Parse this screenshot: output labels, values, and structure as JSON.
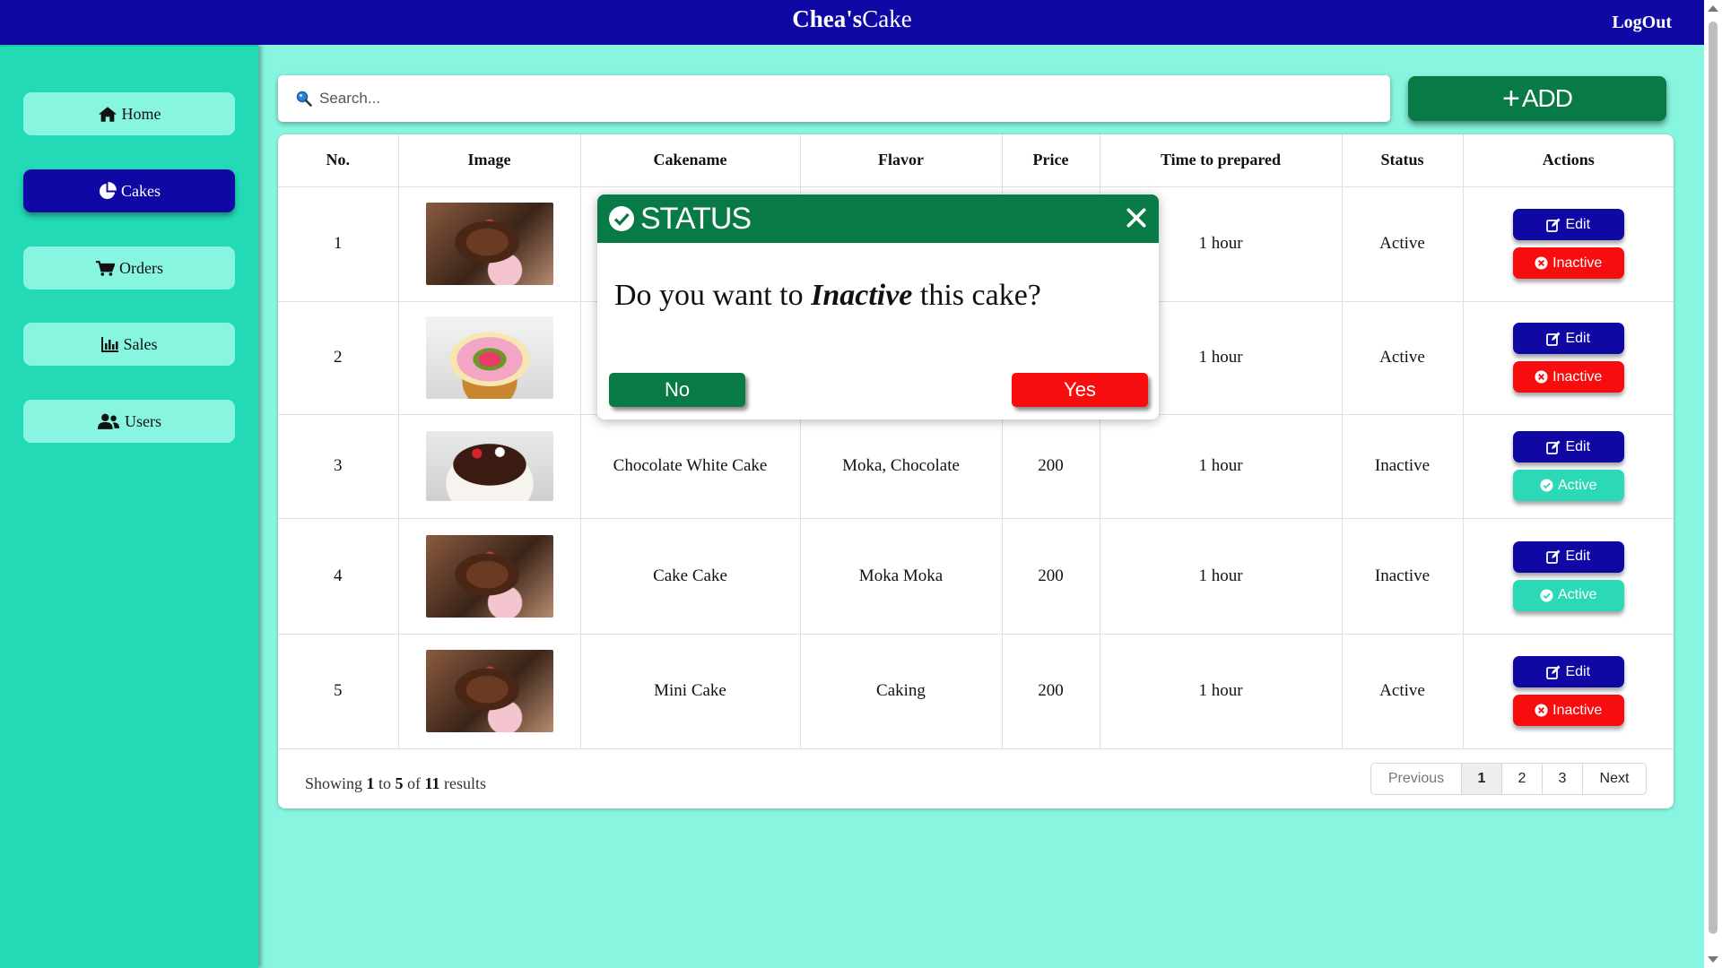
{
  "header": {
    "brand_bold": "Chea's",
    "brand_rest": "Cake",
    "logout": "LogOut"
  },
  "sidebar": {
    "items": [
      {
        "label": "Home",
        "icon": "home-icon"
      },
      {
        "label": "Cakes",
        "icon": "pie-chart-icon",
        "active": true
      },
      {
        "label": "Orders",
        "icon": "cart-icon"
      },
      {
        "label": "Sales",
        "icon": "bar-chart-icon"
      },
      {
        "label": "Users",
        "icon": "users-icon"
      }
    ]
  },
  "search": {
    "placeholder": "Search...",
    "value": ""
  },
  "add_button": {
    "label": "ADD"
  },
  "table": {
    "headers": [
      "No.",
      "Image",
      "Cakename",
      "Flavor",
      "Price",
      "Time to prepared",
      "Status",
      "Actions"
    ],
    "rows": [
      {
        "no": "1",
        "cakename": "",
        "flavor": "",
        "price": "",
        "time": "1 hour",
        "status": "Active",
        "edit": "Edit",
        "toggle": "Inactive"
      },
      {
        "no": "2",
        "cakename": "",
        "flavor": "",
        "price": "",
        "time": "1 hour",
        "status": "Active",
        "edit": "Edit",
        "toggle": "Inactive"
      },
      {
        "no": "3",
        "cakename": "Chocolate White Cake",
        "flavor": "Moka, Chocolate",
        "price": "200",
        "time": "1 hour",
        "status": "Inactive",
        "edit": "Edit",
        "toggle": "Active"
      },
      {
        "no": "4",
        "cakename": "Cake Cake",
        "flavor": "Moka Moka",
        "price": "200",
        "time": "1 hour",
        "status": "Inactive",
        "edit": "Edit",
        "toggle": "Active"
      },
      {
        "no": "5",
        "cakename": "Mini Cake",
        "flavor": "Caking",
        "price": "200",
        "time": "1 hour",
        "status": "Active",
        "edit": "Edit",
        "toggle": "Inactive"
      }
    ]
  },
  "pagination": {
    "showing_prefix": "Showing",
    "from": "1",
    "to_word": "to",
    "to": "5",
    "of_word": "of",
    "total": "11",
    "suffix": "results",
    "previous": "Previous",
    "pages": [
      "1",
      "2",
      "3"
    ],
    "current_page": "1",
    "next": "Next"
  },
  "modal": {
    "title": "STATUS",
    "message_before": "Do you want to",
    "message_emphasis": "Inactive",
    "message_after": "this cake?",
    "no_label": "No",
    "yes_label": "Yes"
  },
  "colors": {
    "header": "#1008a5",
    "sidebar": "#23d9b6",
    "background": "#88f5e0",
    "primary_green": "#087a46",
    "danger_red": "#f70d0d"
  }
}
